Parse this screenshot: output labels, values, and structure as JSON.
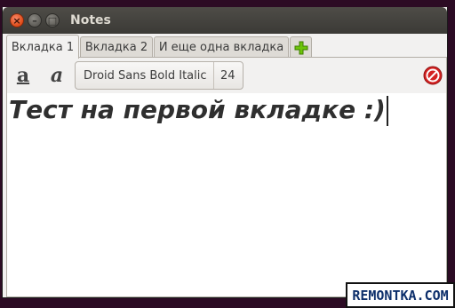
{
  "window": {
    "title": "Notes",
    "close_glyph": "×",
    "minimize_glyph": "–",
    "maximize_glyph": "□"
  },
  "tabs": [
    {
      "label": "Вкладка 1",
      "active": true
    },
    {
      "label": "Вкладка 2",
      "active": false
    },
    {
      "label": "И еще одна вкладка",
      "active": false
    }
  ],
  "add_tab_icon": "green-plus-icon",
  "toolbar": {
    "font_name": "Droid Sans Bold Italic",
    "font_size": "24",
    "regular_font_icon": "a",
    "italic_font_icon": "a"
  },
  "editor": {
    "text": "Тест на первой вкладке :)"
  },
  "watermark": "REMONTKA.COM",
  "colors": {
    "close": "#df4a16",
    "add": "#5fb300",
    "stop": "#d21f1f",
    "desktop": "#2c0b24"
  }
}
